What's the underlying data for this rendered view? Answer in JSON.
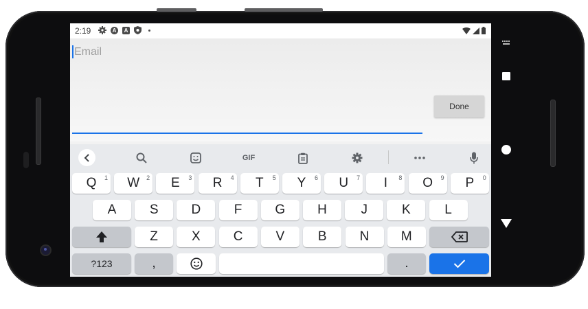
{
  "status_bar": {
    "time": "2:19",
    "left_icons": [
      "settings-icon",
      "a-icon",
      "a-icon",
      "shield-icon"
    ],
    "right_icons": [
      "wifi-icon",
      "signal-icon",
      "battery-icon"
    ]
  },
  "form": {
    "email_placeholder": "Email",
    "email_value": "",
    "done_label": "Done",
    "accent_color": "#1a73e8"
  },
  "keyboard": {
    "toolbar": [
      "back",
      "search",
      "sticker",
      "GIF",
      "clipboard",
      "settings",
      "more",
      "mic"
    ],
    "gif_label": "GIF",
    "row1": [
      {
        "label": "Q",
        "num": "1"
      },
      {
        "label": "W",
        "num": "2"
      },
      {
        "label": "E",
        "num": "3"
      },
      {
        "label": "R",
        "num": "4"
      },
      {
        "label": "T",
        "num": "5"
      },
      {
        "label": "Y",
        "num": "6"
      },
      {
        "label": "U",
        "num": "7"
      },
      {
        "label": "I",
        "num": "8"
      },
      {
        "label": "O",
        "num": "9"
      },
      {
        "label": "P",
        "num": "0"
      }
    ],
    "row2": [
      "A",
      "S",
      "D",
      "F",
      "G",
      "H",
      "J",
      "K",
      "L"
    ],
    "row3": [
      "Z",
      "X",
      "C",
      "V",
      "B",
      "N",
      "M"
    ],
    "symbols_label": "?123",
    "comma_label": ",",
    "period_label": ".",
    "enter_color": "#1a73e8"
  },
  "nav": {
    "icons": [
      "recents-icon",
      "home-icon",
      "back-icon"
    ]
  }
}
